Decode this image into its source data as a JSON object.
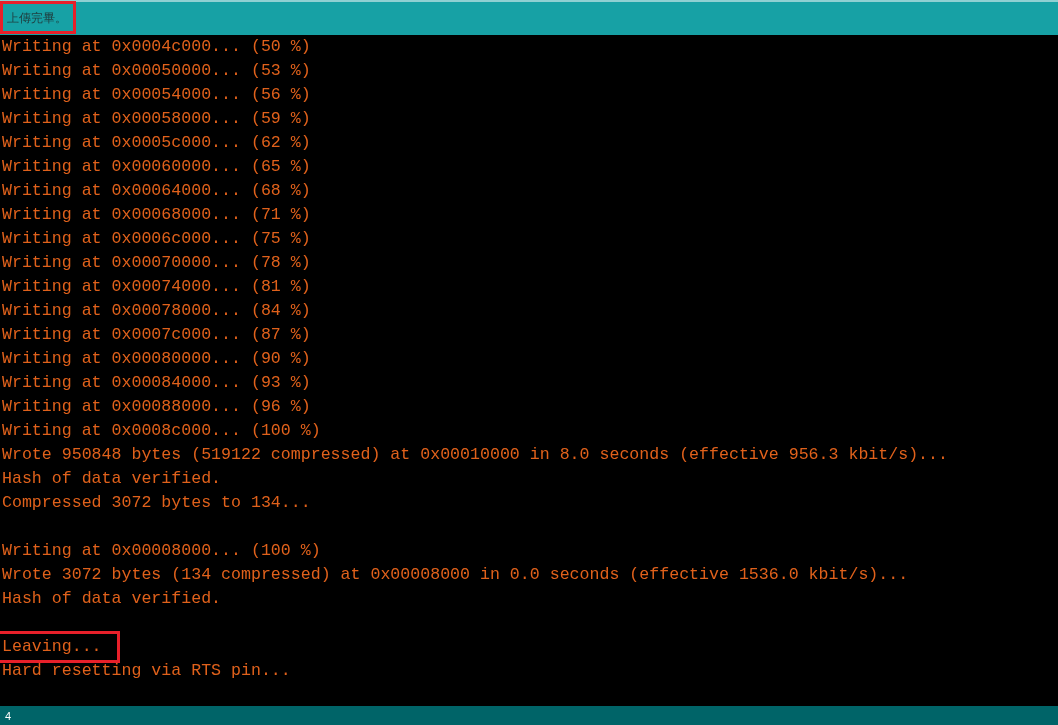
{
  "status_message": {
    "text": "上傳完畢。",
    "highlighted": true
  },
  "console_blocks": [
    {
      "lines": [
        {
          "text": "Writing at 0x0004c000... (50 %)"
        },
        {
          "text": "Writing at 0x00050000... (53 %)"
        },
        {
          "text": "Writing at 0x00054000... (56 %)"
        },
        {
          "text": "Writing at 0x00058000... (59 %)"
        },
        {
          "text": "Writing at 0x0005c000... (62 %)"
        },
        {
          "text": "Writing at 0x00060000... (65 %)"
        },
        {
          "text": "Writing at 0x00064000... (68 %)"
        },
        {
          "text": "Writing at 0x00068000... (71 %)"
        },
        {
          "text": "Writing at 0x0006c000... (75 %)"
        },
        {
          "text": "Writing at 0x00070000... (78 %)"
        },
        {
          "text": "Writing at 0x00074000... (81 %)"
        },
        {
          "text": "Writing at 0x00078000... (84 %)"
        },
        {
          "text": "Writing at 0x0007c000... (87 %)"
        },
        {
          "text": "Writing at 0x00080000... (90 %)"
        },
        {
          "text": "Writing at 0x00084000... (93 %)"
        },
        {
          "text": "Writing at 0x00088000... (96 %)"
        },
        {
          "text": "Writing at 0x0008c000... (100 %)"
        },
        {
          "text": "Wrote 950848 bytes (519122 compressed) at 0x00010000 in 8.0 seconds (effective 956.3 kbit/s)..."
        },
        {
          "text": "Hash of data verified."
        },
        {
          "text": "Compressed 3072 bytes to 134..."
        }
      ]
    },
    {
      "lines": [
        {
          "text": "Writing at 0x00008000... (100 %)"
        },
        {
          "text": "Wrote 3072 bytes (134 compressed) at 0x00008000 in 0.0 seconds (effective 1536.0 kbit/s)..."
        },
        {
          "text": "Hash of data verified."
        }
      ]
    },
    {
      "lines": [
        {
          "text": "Leaving...",
          "highlighted": true
        },
        {
          "text": "Hard resetting via RTS pin..."
        }
      ]
    }
  ],
  "line_number": "4"
}
